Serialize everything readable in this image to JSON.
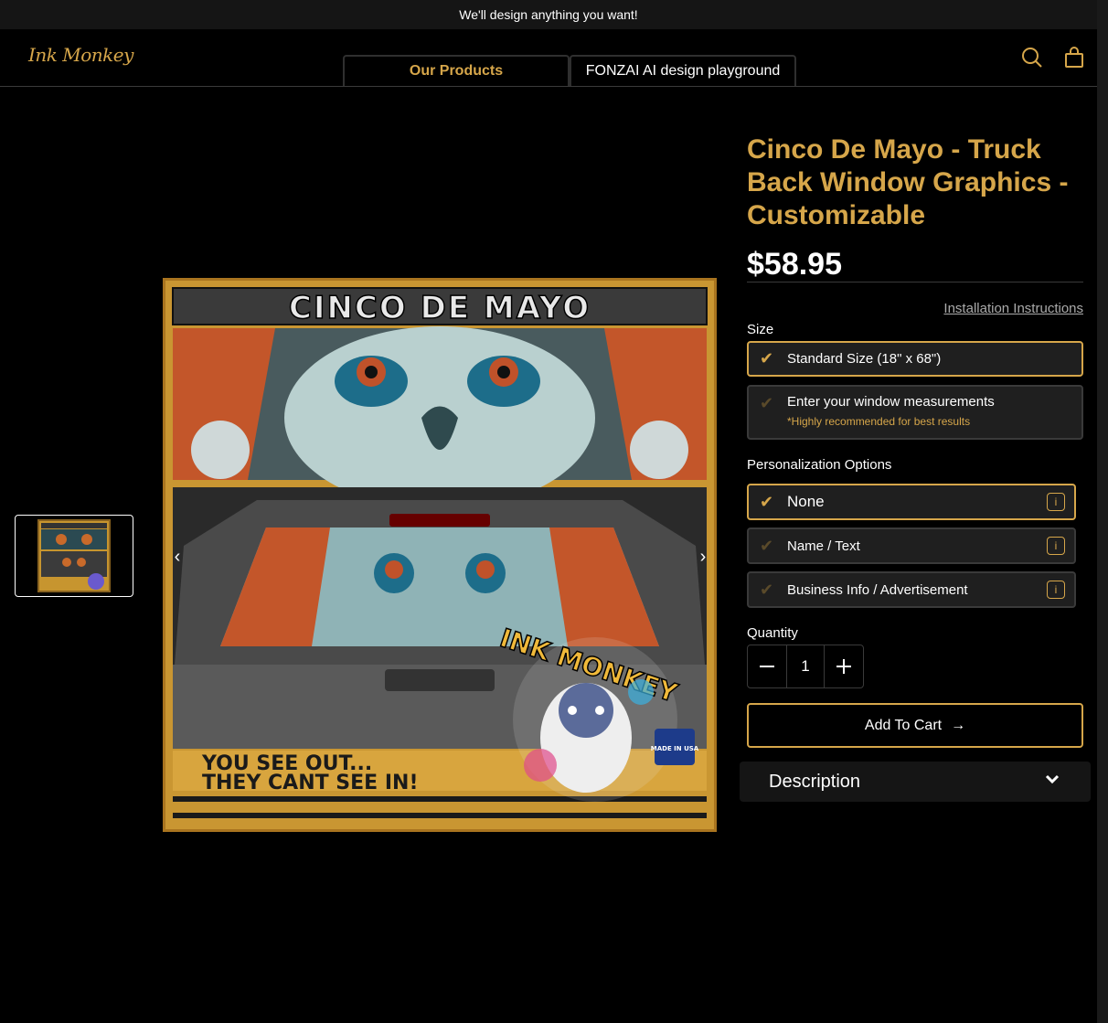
{
  "announcement": "We'll design anything you want!",
  "header": {
    "logo": "Ink Monkey",
    "nav": [
      "Our Products",
      "FONZAI AI design playground"
    ]
  },
  "gallery": {
    "prev_arrow": "‹",
    "next_arrow": "›",
    "image_texts": {
      "banner": "CINCO DE MAYO",
      "tagline_1": "YOU SEE OUT...",
      "tagline_2": "THEY CANT SEE IN!",
      "sticker": "INK MONKEY",
      "badge": "MADE IN USA"
    }
  },
  "product": {
    "title": "Cinco De Mayo - Truck Back Window Graphics - Customizable",
    "price": "$58.95",
    "install_link": "Installation Instructions",
    "size_label": "Size",
    "size_options": [
      {
        "label": "Standard Size (18\" x 68\")",
        "selected": true
      },
      {
        "label": "Enter your window measurements",
        "note": "*Highly recommended for best results",
        "selected": false
      }
    ],
    "personalization_label": "Personalization Options",
    "personalization_options": [
      {
        "label": "None",
        "selected": true
      },
      {
        "label": "Name / Text",
        "selected": false
      },
      {
        "label": "Business Info / Advertisement",
        "selected": false
      }
    ],
    "quantity_label": "Quantity",
    "quantity": "1",
    "add_to_cart": "Add To Cart",
    "description_label": "Description"
  },
  "colors": {
    "accent": "#d6a64a",
    "background": "#000000",
    "panel": "#1f1f1f"
  }
}
